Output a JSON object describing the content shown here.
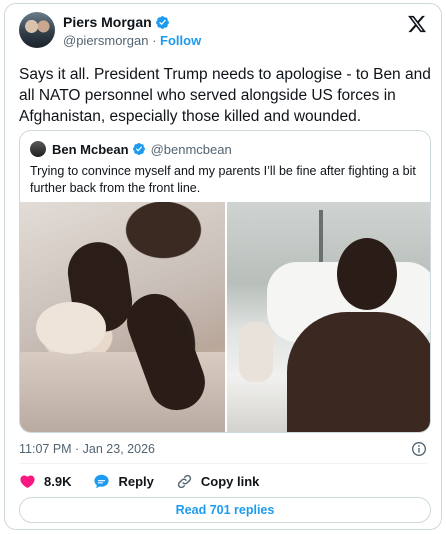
{
  "author": {
    "name": "Piers Morgan",
    "handle": "@piersmorgan",
    "separator": "·",
    "follow_label": "Follow"
  },
  "tweet": {
    "text": "Says it all. President Trump needs to apologise - to Ben and all NATO personnel who served alongside US forces in Afghanistan, especially those killed and wounded."
  },
  "quoted": {
    "name": "Ben Mcbean",
    "handle": "@benmcbean",
    "text": "Trying to convince myself and my parents I’ll be fine after fighting a bit further back from the front line."
  },
  "meta": {
    "timestamp": "11:07 PM · Jan 23, 2026"
  },
  "actions": {
    "likes": "8.9K",
    "reply_label": "Reply",
    "copy_link_label": "Copy link"
  },
  "read_replies_label": "Read 701 replies",
  "colors": {
    "accent": "#1d9bf0",
    "like": "#f91880",
    "muted": "#536471"
  },
  "icons": [
    "verified-badge-icon",
    "x-logo-icon",
    "info-icon",
    "heart-icon",
    "reply-icon",
    "link-icon"
  ]
}
